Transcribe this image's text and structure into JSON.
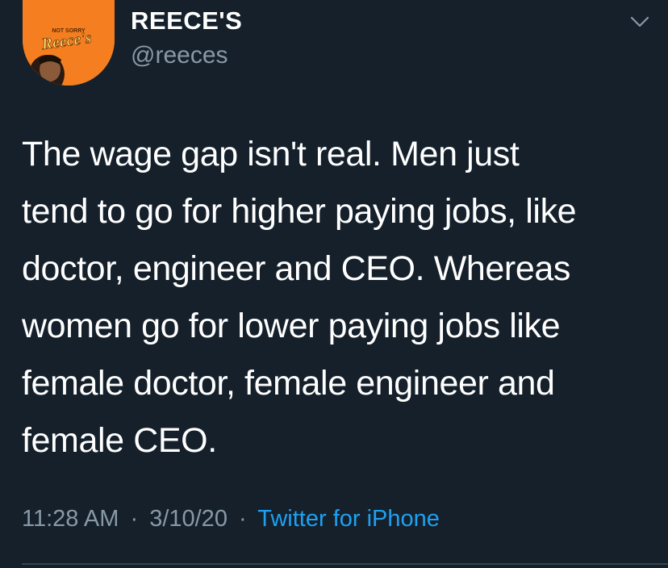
{
  "author": {
    "display_name": "REECE'S",
    "handle": "@reeces",
    "avatar_logo_text": "Reece's",
    "avatar_tagline": "NOT SORRY"
  },
  "tweet": {
    "lines": [
      "The wage gap isn't real. Men just",
      "tend to go for higher paying jobs, like",
      "doctor, engineer and CEO. Whereas",
      "women go for lower paying jobs like",
      "female doctor, female engineer and",
      "female CEO."
    ]
  },
  "meta": {
    "time": "11:28 AM",
    "separator": "·",
    "date": "3/10/20",
    "source": "Twitter for iPhone"
  },
  "icons": {
    "menu": "chevron-down-icon"
  },
  "colors": {
    "background": "#15202b",
    "text": "#ffffff",
    "secondary": "#8899a6",
    "accent": "#1da1f2",
    "avatar_orange": "#f57f20"
  }
}
